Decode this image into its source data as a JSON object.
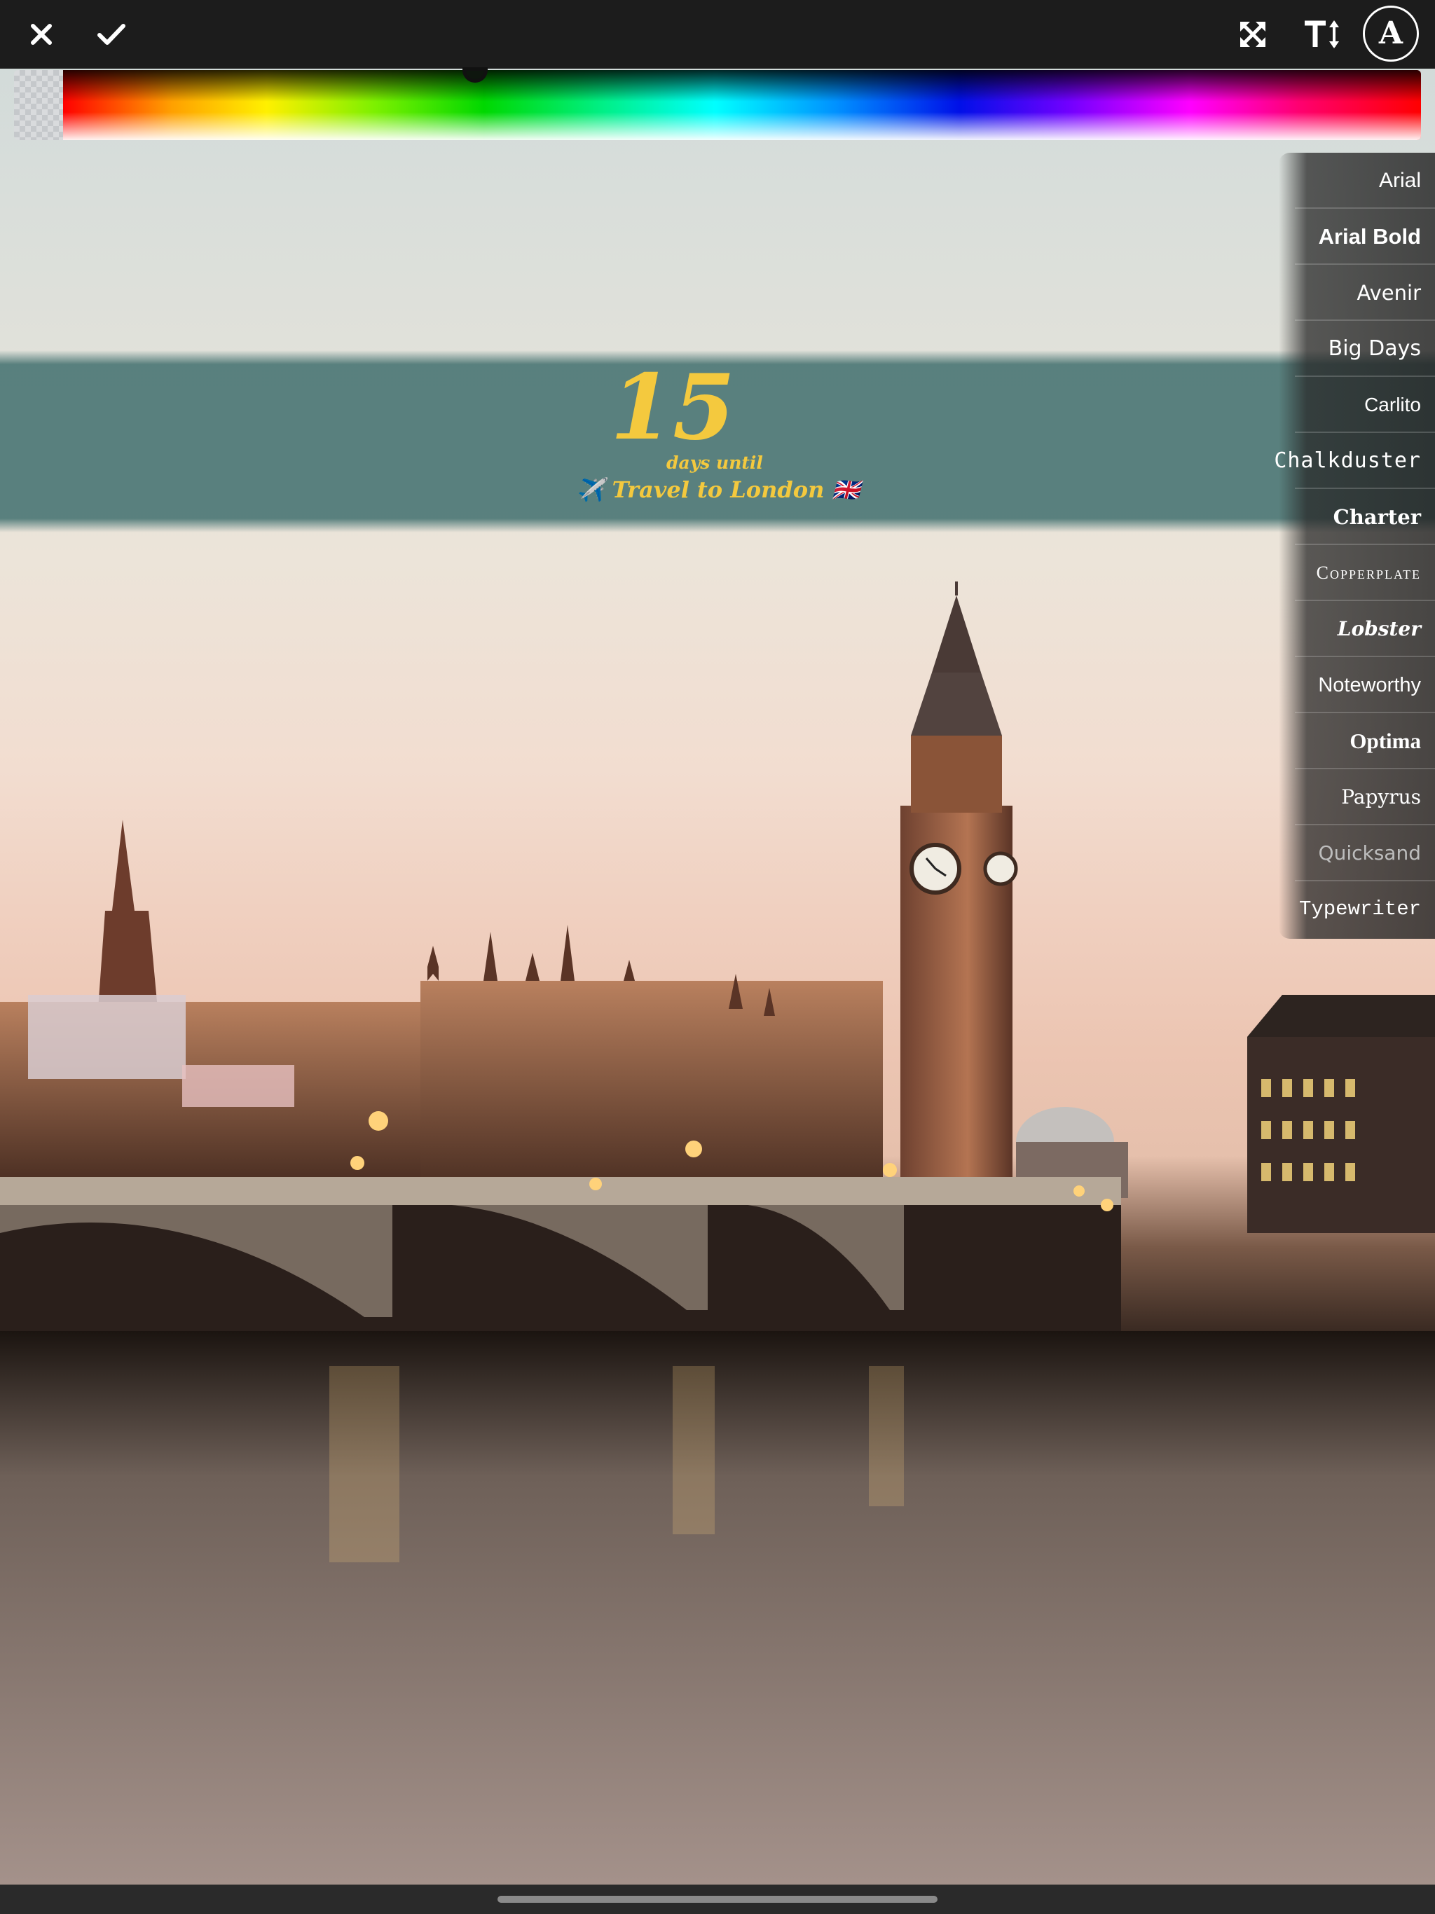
{
  "toolbar": {
    "close_icon": "close-x-icon",
    "done_icon": "checkmark-icon",
    "expand_icon": "expand-arrows-icon",
    "text_size_icon": "text-size-icon",
    "font_button_label": "A"
  },
  "color_picker": {
    "accent_selected": "#00c800"
  },
  "banner": {
    "number": "15",
    "caption": "days until",
    "title": "✈️ Travel to London 🇬🇧",
    "text_color": "#f4c93e",
    "background_color": "#4d7876"
  },
  "font_menu": {
    "items": [
      {
        "label": "Arial"
      },
      {
        "label": "Arial Bold"
      },
      {
        "label": "Avenir"
      },
      {
        "label": "Big Days"
      },
      {
        "label": "Carlito"
      },
      {
        "label": "Chalkduster"
      },
      {
        "label": "Charter"
      },
      {
        "label": "Copperplate"
      },
      {
        "label": "Lobster"
      },
      {
        "label": "Noteworthy"
      },
      {
        "label": "Optima"
      },
      {
        "label": "Papyrus"
      },
      {
        "label": "Quicksand"
      },
      {
        "label": "Typewriter"
      }
    ]
  }
}
